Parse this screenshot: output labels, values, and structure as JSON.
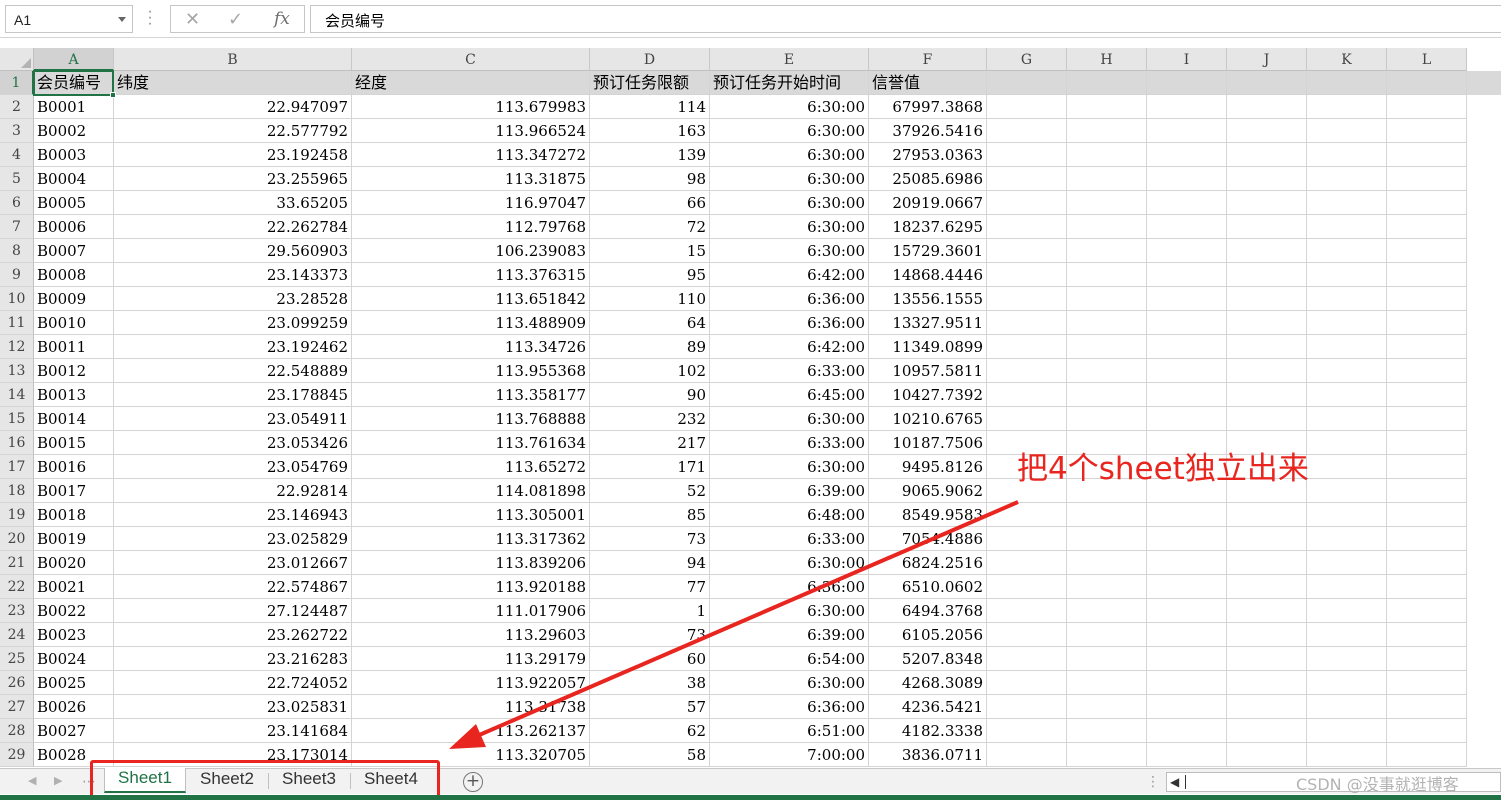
{
  "name_box": "A1",
  "formula_bar": {
    "cancel_icon": "close-icon",
    "enter_icon": "check-icon",
    "fx_label": "fx",
    "value": "会员编号"
  },
  "columns": [
    "A",
    "B",
    "C",
    "D",
    "E",
    "F",
    "G",
    "H",
    "I",
    "J",
    "K",
    "L"
  ],
  "header_row": {
    "row_number": "1",
    "cells": [
      "会员编号",
      "纬度",
      "经度",
      "预订任务限额",
      "预订任务开始时间",
      "信誉值"
    ]
  },
  "rows": [
    {
      "n": "2",
      "c": [
        "B0001",
        "22.947097",
        "113.679983",
        "114",
        "6:30:00",
        "67997.3868"
      ]
    },
    {
      "n": "3",
      "c": [
        "B0002",
        "22.577792",
        "113.966524",
        "163",
        "6:30:00",
        "37926.5416"
      ]
    },
    {
      "n": "4",
      "c": [
        "B0003",
        "23.192458",
        "113.347272",
        "139",
        "6:30:00",
        "27953.0363"
      ]
    },
    {
      "n": "5",
      "c": [
        "B0004",
        "23.255965",
        "113.31875",
        "98",
        "6:30:00",
        "25085.6986"
      ]
    },
    {
      "n": "6",
      "c": [
        "B0005",
        "33.65205",
        "116.97047",
        "66",
        "6:30:00",
        "20919.0667"
      ]
    },
    {
      "n": "7",
      "c": [
        "B0006",
        "22.262784",
        "112.79768",
        "72",
        "6:30:00",
        "18237.6295"
      ]
    },
    {
      "n": "8",
      "c": [
        "B0007",
        "29.560903",
        "106.239083",
        "15",
        "6:30:00",
        "15729.3601"
      ]
    },
    {
      "n": "9",
      "c": [
        "B0008",
        "23.143373",
        "113.376315",
        "95",
        "6:42:00",
        "14868.4446"
      ]
    },
    {
      "n": "10",
      "c": [
        "B0009",
        "23.28528",
        "113.651842",
        "110",
        "6:36:00",
        "13556.1555"
      ]
    },
    {
      "n": "11",
      "c": [
        "B0010",
        "23.099259",
        "113.488909",
        "64",
        "6:36:00",
        "13327.9511"
      ]
    },
    {
      "n": "12",
      "c": [
        "B0011",
        "23.192462",
        "113.34726",
        "89",
        "6:42:00",
        "11349.0899"
      ]
    },
    {
      "n": "13",
      "c": [
        "B0012",
        "22.548889",
        "113.955368",
        "102",
        "6:33:00",
        "10957.5811"
      ]
    },
    {
      "n": "14",
      "c": [
        "B0013",
        "23.178845",
        "113.358177",
        "90",
        "6:45:00",
        "10427.7392"
      ]
    },
    {
      "n": "15",
      "c": [
        "B0014",
        "23.054911",
        "113.768888",
        "232",
        "6:30:00",
        "10210.6765"
      ]
    },
    {
      "n": "16",
      "c": [
        "B0015",
        "23.053426",
        "113.761634",
        "217",
        "6:33:00",
        "10187.7506"
      ]
    },
    {
      "n": "17",
      "c": [
        "B0016",
        "23.054769",
        "113.65272",
        "171",
        "6:30:00",
        "9495.8126"
      ]
    },
    {
      "n": "18",
      "c": [
        "B0017",
        "22.92814",
        "114.081898",
        "52",
        "6:39:00",
        "9065.9062"
      ]
    },
    {
      "n": "19",
      "c": [
        "B0018",
        "23.146943",
        "113.305001",
        "85",
        "6:48:00",
        "8549.9583"
      ]
    },
    {
      "n": "20",
      "c": [
        "B0019",
        "23.025829",
        "113.317362",
        "73",
        "6:33:00",
        "7054.4886"
      ]
    },
    {
      "n": "21",
      "c": [
        "B0020",
        "23.012667",
        "113.839206",
        "94",
        "6:30:00",
        "6824.2516"
      ]
    },
    {
      "n": "22",
      "c": [
        "B0021",
        "22.574867",
        "113.920188",
        "77",
        "6:36:00",
        "6510.0602"
      ]
    },
    {
      "n": "23",
      "c": [
        "B0022",
        "27.124487",
        "111.017906",
        "1",
        "6:30:00",
        "6494.3768"
      ]
    },
    {
      "n": "24",
      "c": [
        "B0023",
        "23.262722",
        "113.29603",
        "73",
        "6:39:00",
        "6105.2056"
      ]
    },
    {
      "n": "25",
      "c": [
        "B0024",
        "23.216283",
        "113.29179",
        "60",
        "6:54:00",
        "5207.8348"
      ]
    },
    {
      "n": "26",
      "c": [
        "B0025",
        "22.724052",
        "113.922057",
        "38",
        "6:30:00",
        "4268.3089"
      ]
    },
    {
      "n": "27",
      "c": [
        "B0026",
        "23.025831",
        "113.31738",
        "57",
        "6:36:00",
        "4236.5421"
      ]
    },
    {
      "n": "28",
      "c": [
        "B0027",
        "23.141684",
        "113.262137",
        "62",
        "6:51:00",
        "4182.3338"
      ]
    },
    {
      "n": "29",
      "c": [
        "B0028",
        "23.173014",
        "113.320705",
        "58",
        "7:00:00",
        "3836.0711"
      ]
    }
  ],
  "sheet_tabs": [
    "Sheet1",
    "Sheet2",
    "Sheet3",
    "Sheet4"
  ],
  "active_sheet": "Sheet1",
  "add_sheet_icon": "plus-circle-icon",
  "annotation": "把4个sheet独立出来",
  "annotation_color": "#e8251f",
  "accent_color": "#217346",
  "watermark": "CSDN @没事就逛博客"
}
